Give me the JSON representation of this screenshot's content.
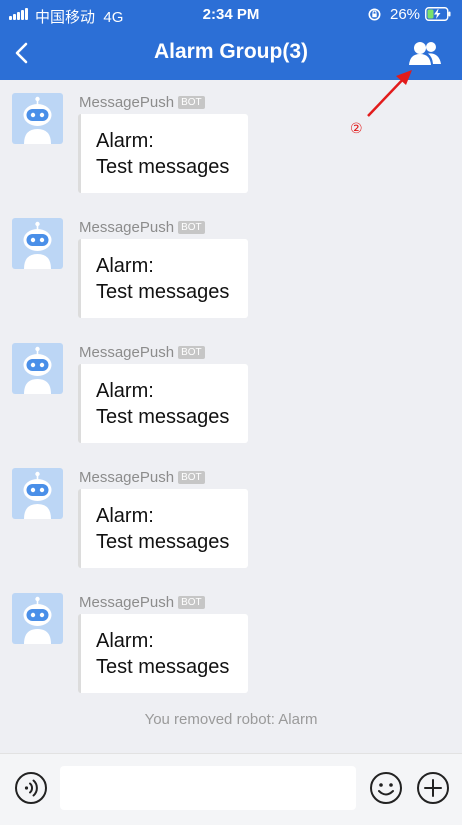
{
  "status_bar": {
    "carrier": "中国移动",
    "network": "4G",
    "time": "2:34 PM",
    "battery_percent": "26%"
  },
  "header": {
    "title": "Alarm Group(3)",
    "back_icon": "chevron-left-icon",
    "members_icon": "group-members-icon"
  },
  "annotation": {
    "label": "②",
    "color": "#e21b1b"
  },
  "messages": [
    {
      "sender": "MessagePush",
      "badge": "BOT",
      "line1": "Alarm:",
      "line2": "Test messages"
    },
    {
      "sender": "MessagePush",
      "badge": "BOT",
      "line1": "Alarm:",
      "line2": "Test messages"
    },
    {
      "sender": "MessagePush",
      "badge": "BOT",
      "line1": "Alarm:",
      "line2": "Test messages"
    },
    {
      "sender": "MessagePush",
      "badge": "BOT",
      "line1": "Alarm:",
      "line2": "Test messages"
    },
    {
      "sender": "MessagePush",
      "badge": "BOT",
      "line1": "Alarm:",
      "line2": "Test messages"
    }
  ],
  "system_note": "You removed robot: Alarm",
  "composer": {
    "input_value": "",
    "voice_icon": "voice-icon",
    "emoji_icon": "emoji-icon",
    "plus_icon": "plus-icon"
  },
  "colors": {
    "accent": "#2c6fd6",
    "background": "#eeeff3",
    "bubble": "#ffffff",
    "avatar_bg": "#bcd6f5"
  }
}
